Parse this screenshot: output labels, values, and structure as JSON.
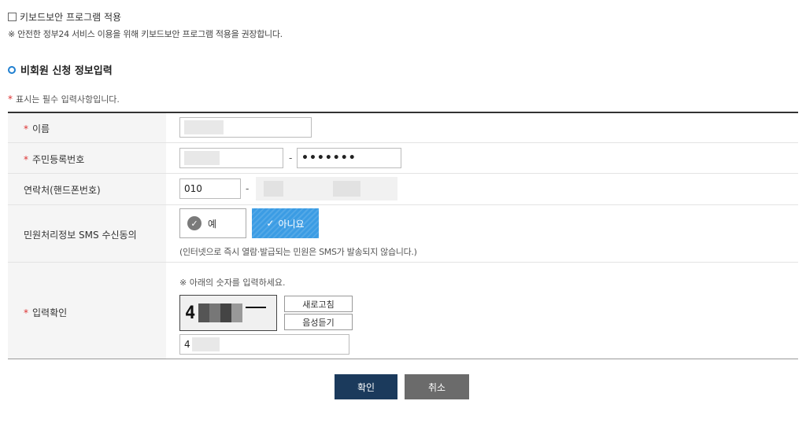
{
  "keyboard_security": {
    "checkbox_label": "키보드보안 프로그램 적용",
    "notice": "※ 안전한 정부24 서비스 이용을 위해 키보드보안 프로그램 적용을 권장합니다."
  },
  "section": {
    "title": "비회원 신청 정보입력",
    "required_star": "*",
    "required_note": "표시는 필수 입력사항입니다."
  },
  "form": {
    "name": {
      "label": "이름",
      "required": true,
      "value": ""
    },
    "rrn": {
      "label": "주민등록번호",
      "required": true,
      "front_value": "",
      "separator": "-",
      "back_value": "•••••••"
    },
    "phone": {
      "label": "연락처(핸드폰번호)",
      "prefix": "010",
      "separator": "-"
    },
    "sms": {
      "label": "민원처리정보 SMS 수신동의",
      "yes_label": "예",
      "no_label": "아니요",
      "selected": "no",
      "note": "(인터넷으로 즉시 열람·발급되는 민원은 SMS가 발송되지 않습니다.)"
    },
    "captcha": {
      "label": "입력확인",
      "required": true,
      "instruction": "※ 아래의 숫자를 입력하세요.",
      "image_first_digit": "4",
      "refresh_label": "새로고침",
      "audio_label": "음성듣기",
      "input_value": "4"
    }
  },
  "actions": {
    "confirm_label": "확인",
    "cancel_label": "취소"
  },
  "colors": {
    "accent": "#1f7fd0",
    "selected_option": "#3b9ce4",
    "confirm_button": "#1b3a5c",
    "cancel_button": "#6b6b6b",
    "required_star": "#dd3333"
  }
}
